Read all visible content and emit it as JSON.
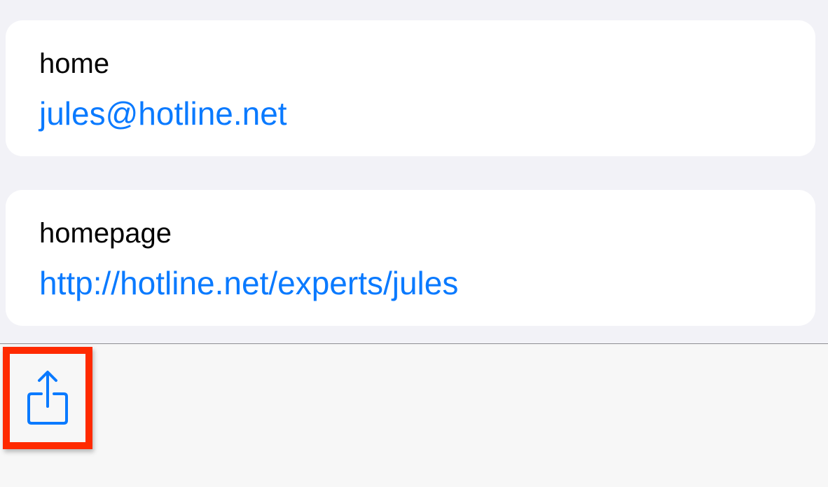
{
  "contact_fields": [
    {
      "label": "home",
      "value": "jules@hotline.net"
    },
    {
      "label": "homepage",
      "value": "http://hotline.net/experts/jules"
    }
  ],
  "toolbar": {
    "share_icon": "share-icon"
  },
  "colors": {
    "link": "#0a7aff",
    "background": "#f2f2f7",
    "card": "#ffffff",
    "highlight": "#ff2a00"
  }
}
